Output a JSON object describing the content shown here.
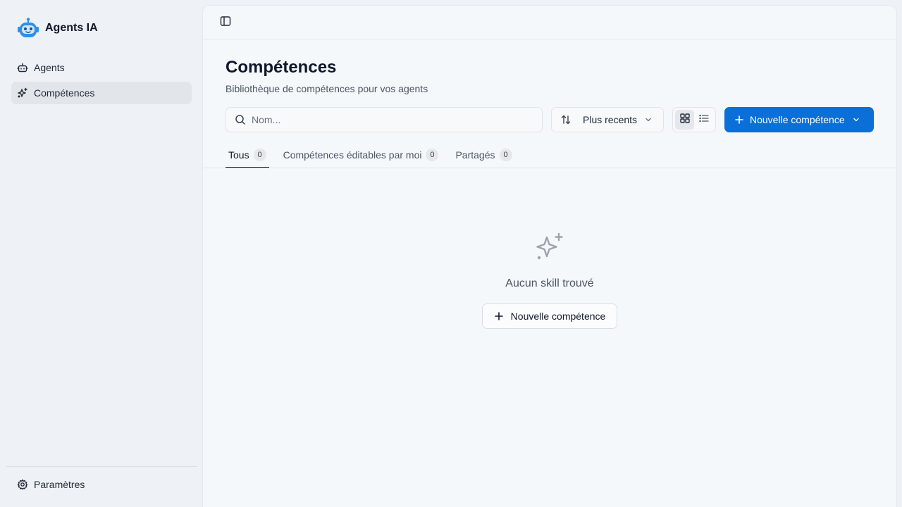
{
  "app": {
    "name": "Agents IA",
    "logo_icon": "robot-icon",
    "accent_color": "#0a6fd6"
  },
  "sidebar": {
    "items": [
      {
        "label": "Agents",
        "icon": "bot-icon",
        "active": false
      },
      {
        "label": "Compétences",
        "icon": "sparkles-icon",
        "active": true
      }
    ],
    "footer": {
      "label": "Paramètres",
      "icon": "gear-icon"
    }
  },
  "topbar": {
    "toggle_icon": "sidebar-toggle-icon"
  },
  "page": {
    "title": "Compétences",
    "subtitle": "Bibliothèque de compétences pour vos agents"
  },
  "toolbar": {
    "search": {
      "placeholder": "Nom...",
      "value": "",
      "icon": "search-icon"
    },
    "sort": {
      "label": "Plus recents",
      "icon": "sort-arrows-icon"
    },
    "view_modes": [
      {
        "icon": "grid-icon",
        "active": true
      },
      {
        "icon": "list-icon",
        "active": false
      }
    ],
    "new_button": {
      "label": "Nouvelle compétence",
      "icon": "plus-icon"
    }
  },
  "tabs": [
    {
      "label": "Tous",
      "count": "0",
      "active": true
    },
    {
      "label": "Compétences éditables par moi",
      "count": "0",
      "active": false
    },
    {
      "label": "Partagés",
      "count": "0",
      "active": false
    }
  ],
  "empty_state": {
    "icon": "sparkles-icon",
    "message": "Aucun skill trouvé",
    "button_label": "Nouvelle compétence"
  }
}
